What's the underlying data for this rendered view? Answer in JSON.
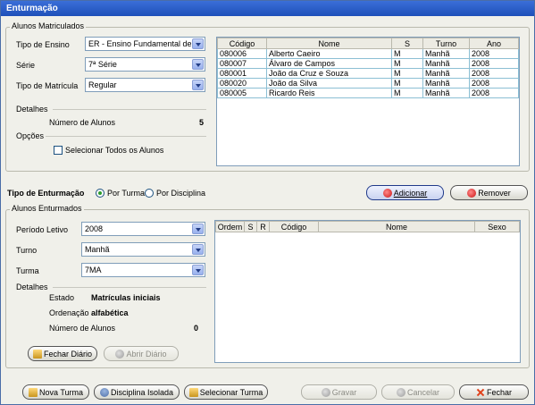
{
  "window": {
    "title": "Enturmação"
  },
  "alunos_matriculados": {
    "legend": "Alunos Matriculados",
    "tipo_ensino": {
      "label": "Tipo de Ensino",
      "value": "ER - Ensino Fundamental de ..."
    },
    "serie": {
      "label": "Série",
      "value": "7ª Série"
    },
    "tipo_matricula": {
      "label": "Tipo de Matrícula",
      "value": "Regular"
    },
    "detalhes_label": "Detalhes",
    "numero_alunos_label": "Número de Alunos",
    "numero_alunos_value": "5",
    "opcoes_label": "Opções",
    "selecionar_todos_label": "Selecionar Todos os Alunos",
    "table": {
      "columns": [
        "Código",
        "Nome",
        "S",
        "Turno",
        "Ano"
      ],
      "rows": [
        [
          "080006",
          "Alberto Caeiro",
          "M",
          "Manhã",
          "2008"
        ],
        [
          "080007",
          "Álvaro de Campos",
          "M",
          "Manhã",
          "2008"
        ],
        [
          "080001",
          "João da Cruz e Souza",
          "M",
          "Manhã",
          "2008"
        ],
        [
          "080020",
          "João da Silva",
          "M",
          "Manhã",
          "2008"
        ],
        [
          "080005",
          "Ricardo Reis",
          "M",
          "Manhã",
          "2008"
        ]
      ]
    }
  },
  "tipo_enturmacao": {
    "label": "Tipo de Enturmação",
    "por_turma": "Por Turma",
    "por_disciplina": "Por Disciplina",
    "adicionar": "Adicionar",
    "remover": "Remover"
  },
  "alunos_enturmados": {
    "legend": "Alunos Enturmados",
    "periodo": {
      "label": "Período Letivo",
      "value": "2008"
    },
    "turno": {
      "label": "Turno",
      "value": "Manhã"
    },
    "turma": {
      "label": "Turma",
      "value": "7MA"
    },
    "detalhes_label": "Detalhes",
    "estado_label": "Estado",
    "estado_value": "Matrículas iniciais",
    "ordenacao_label": "Ordenação",
    "ordenacao_value": "alfabética",
    "numero_alunos_label": "Número de Alunos",
    "numero_alunos_value": "0",
    "fechar_diario": "Fechar Diário",
    "abrir_diario": "Abrir Diário",
    "table": {
      "columns": [
        "Ordem",
        "S",
        "R",
        "Código",
        "Nome",
        "Sexo"
      ]
    }
  },
  "footer": {
    "nova_turma": "Nova Turma",
    "disciplina_isolada": "Disciplina Isolada",
    "selecionar_turma": "Selecionar Turma",
    "gravar": "Gravar",
    "cancelar": "Cancelar",
    "fechar": "Fechar"
  }
}
